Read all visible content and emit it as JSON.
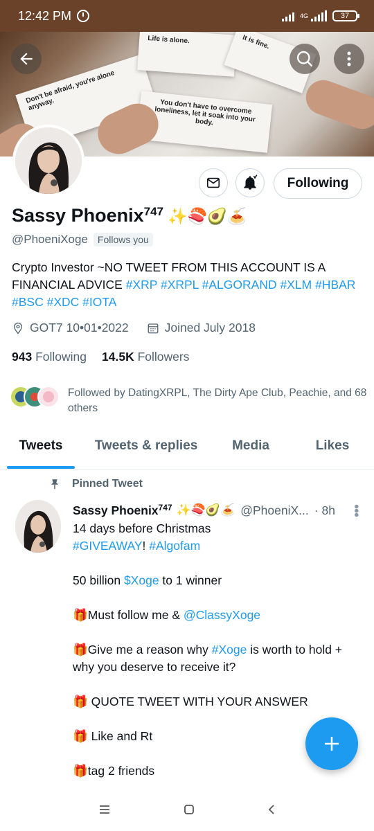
{
  "status_bar": {
    "time": "12:42 PM",
    "network": "4G",
    "battery": "37"
  },
  "banner": {
    "texts": [
      "Don't be afraid, you're alone anyway.",
      "Life is alone.",
      "It is fine.",
      "You don't have to overcome loneliness, let it soak into your body."
    ]
  },
  "profile": {
    "name": "Sassy Phoenix",
    "name_sup": "747",
    "name_emoji": "✨🍣🥑🍝",
    "handle": "@PhoeniXoge",
    "follows_you": "Follows you",
    "follow_button": "Following",
    "bio_text": "Crypto Investor ~NO TWEET FROM THIS ACCOUNT IS A FINANCIAL ADVICE",
    "bio_tags": [
      "#XRP",
      "#XRPL",
      "#ALGORAND",
      "#XLM",
      "#HBAR",
      "#BSC",
      "#XDC",
      "#IOTA"
    ],
    "location": "GOT7 10•01•2022",
    "joined": "Joined July 2018",
    "following_count": "943",
    "following_label": "Following",
    "followers_count": "14.5K",
    "followers_label": "Followers",
    "followed_by": "Followed by DatingXRPL, The Dirty Ape Club, Peachie, and 68 others"
  },
  "tabs": [
    {
      "label": "Tweets",
      "active": true
    },
    {
      "label": "Tweets & replies",
      "active": false
    },
    {
      "label": "Media",
      "active": false
    },
    {
      "label": "Likes",
      "active": false
    }
  ],
  "tweet": {
    "pinned_label": "Pinned Tweet",
    "author": "Sassy Phoenix",
    "author_sup": "747",
    "author_emoji": "✨🍣🥑🍝",
    "handle": "@PhoeniX...",
    "time": "· 8h",
    "line1": "14 days before Christmas",
    "line2_tag1": "#GIVEAWAY",
    "line2_sep": "! ",
    "line2_tag2": "#Algofam",
    "line3_pre": "50 billion ",
    "line3_tag": "$Xoge",
    "line3_post": " to 1 winner",
    "line4_pre": "🎁Must follow me & ",
    "line4_tag": "@ClassyXoge",
    "line5_pre": "🎁Give me a reason why ",
    "line5_tag": "#Xoge",
    "line5_post": " is worth to hold + why you deserve to receive it?",
    "line6": "🎁 QUOTE TWEET WITH YOUR ANSWER",
    "line7": "🎁 Like and Rt",
    "line8": "🎁tag 2 friends"
  },
  "colors": {
    "accent": "#1d9bf0",
    "status_bar": "#6a4229",
    "muted_text": "#536471"
  },
  "icons": [
    "back-arrow-icon",
    "search-icon",
    "more-vertical-icon",
    "mail-icon",
    "bell-plus-icon",
    "location-icon",
    "calendar-icon",
    "pin-icon",
    "plus-icon",
    "menu-icon",
    "home-square-icon",
    "back-chevron-icon"
  ]
}
